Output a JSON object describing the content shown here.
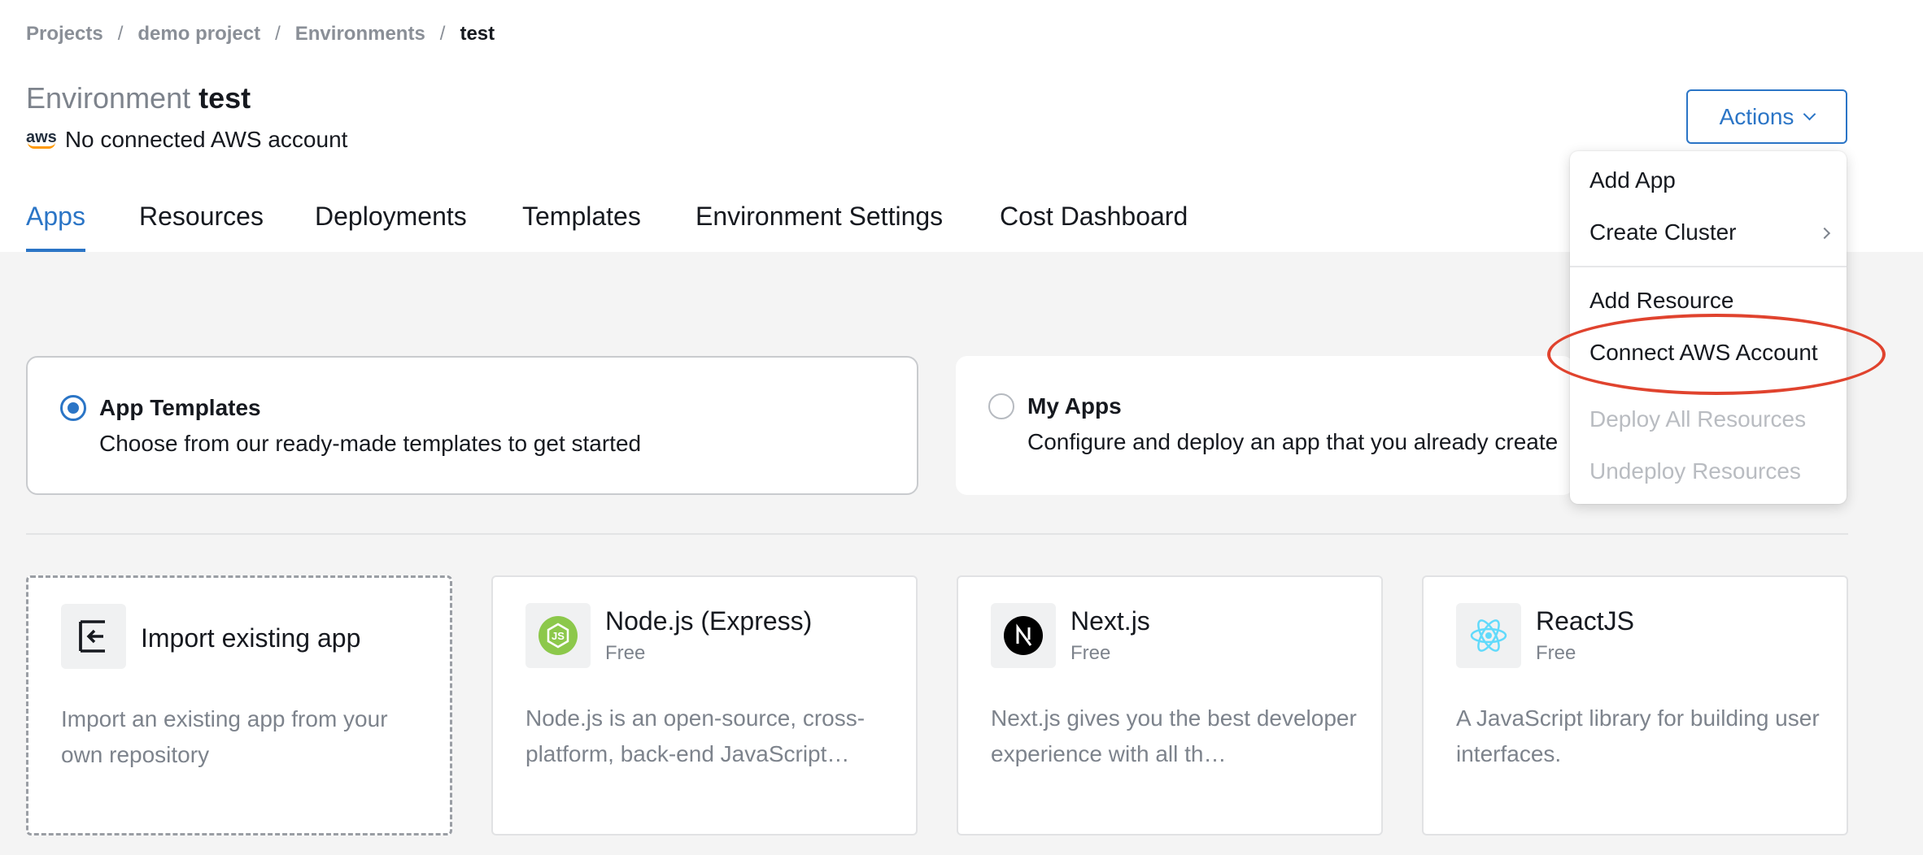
{
  "breadcrumb": {
    "items": [
      "Projects",
      "demo project",
      "Environments",
      "test"
    ],
    "separator": "/"
  },
  "environment": {
    "label": "Environment",
    "name": "test",
    "aws_logo_text": "aws",
    "aws_status": "No connected AWS account"
  },
  "actions": {
    "label": "Actions",
    "menu": {
      "items": [
        {
          "label": "Add App",
          "disabled": false
        },
        {
          "label": "Create Cluster",
          "disabled": false,
          "submenu": true
        },
        {
          "label": "Add Resource",
          "disabled": false
        },
        {
          "label": "Connect AWS Account",
          "disabled": false,
          "highlighted": true
        },
        {
          "label": "Deploy All Resources",
          "disabled": true
        },
        {
          "label": "Undeploy Resources",
          "disabled": true
        }
      ]
    }
  },
  "tabs": [
    {
      "label": "Apps",
      "active": true
    },
    {
      "label": "Resources",
      "active": false
    },
    {
      "label": "Deployments",
      "active": false
    },
    {
      "label": "Templates",
      "active": false
    },
    {
      "label": "Environment Settings",
      "active": false
    },
    {
      "label": "Cost Dashboard",
      "active": false
    }
  ],
  "source_choice": {
    "options": [
      {
        "title": "App Templates",
        "description": "Choose from our ready-made templates to get started",
        "selected": true
      },
      {
        "title": "My Apps",
        "description": "Configure and deploy an app that you already create",
        "selected": false
      }
    ]
  },
  "cards": [
    {
      "title": "Import existing app",
      "subtitle": "",
      "description": "Import an existing app from your own repository",
      "icon": "import-icon"
    },
    {
      "title": "Node.js (Express)",
      "subtitle": "Free",
      "description": "Node.js is an open-source, cross-platform, back-end JavaScript…",
      "icon": "nodejs-icon"
    },
    {
      "title": "Next.js",
      "subtitle": "Free",
      "description": "Next.js gives you the best developer experience with all th…",
      "icon": "nextjs-icon"
    },
    {
      "title": "ReactJS",
      "subtitle": "Free",
      "description": "A JavaScript library for building user interfaces.",
      "icon": "react-icon"
    }
  ],
  "colors": {
    "accent": "#2b75c6",
    "highlight_ring": "#e0432e",
    "nodejs_green": "#8cc84b",
    "react_blue": "#61dafb"
  }
}
